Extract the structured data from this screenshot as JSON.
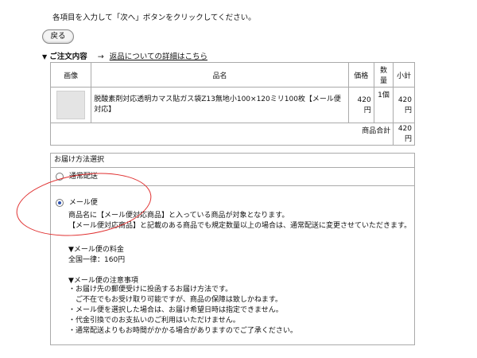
{
  "instruction": "各項目を入力して「次へ」ボタンをクリックしてください。",
  "back_button": "戻る",
  "order_section": {
    "marker": "▼",
    "title": "ご注文内容",
    "arrow": "→",
    "link": "返品についての詳細はこちら"
  },
  "order_table": {
    "headers": [
      "画像",
      "品名",
      "価格",
      "数量",
      "小計"
    ],
    "rows": [
      {
        "name": "脱酸素剤対応透明カマス貼ガス袋Z13無地小100×120ミリ100枚【メール便対応】",
        "price": "420円",
        "quantity": "1個",
        "subtotal": "420円"
      }
    ],
    "total_label": "商品合計",
    "total_value": "420円"
  },
  "shipping": {
    "header": "お届け方法選択",
    "option_standard": "通常配送",
    "option_mail": "メール便",
    "selected": "メール便",
    "mail_description": [
      "商品名に【メール便対応商品】と入っている商品が対象となります。",
      "【メール便対応商品】と記載のある商品でも規定数量以上の場合は、通常配送に変更させていただきます。"
    ],
    "rate_title": "▼メール便の料金",
    "rate": "全国一律：160円",
    "notes_title": "▼メール便の注意事項",
    "notes": [
      "・お届け先の郵便受けに投函するお届け方法です。",
      "　ご不在でもお受け取り可能ですが、商品の保障は致しかねます。",
      "・メール便を選択した場合は、お届け希望日時は指定できません。",
      "・代金引換でのお支払いのご利用はいただけません。",
      "・通常配送よりもお時間がかかる場合がありますのでご了承ください。"
    ]
  },
  "annotation_color": "#e03030"
}
